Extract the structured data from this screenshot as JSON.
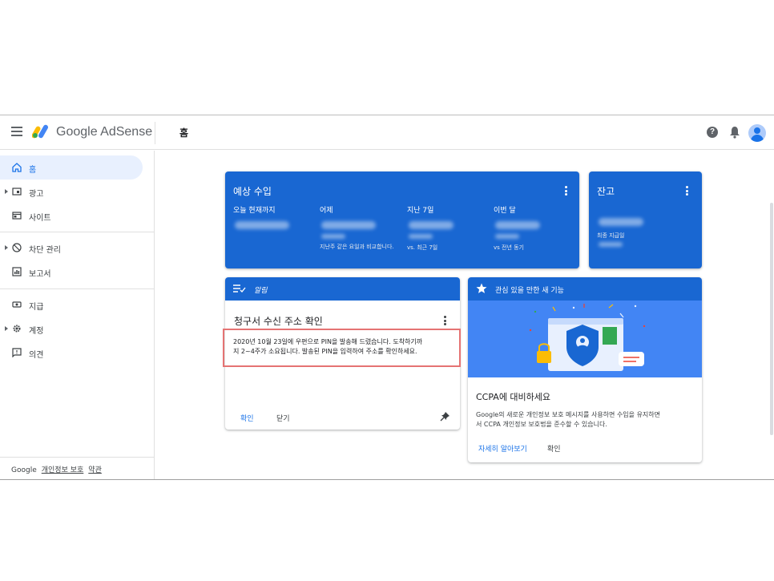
{
  "app": {
    "brand": "Google AdSense",
    "page_title": "홈"
  },
  "colors": {
    "primary": "#1967d2",
    "accent": "#1a73e8",
    "highlight_border": "#e57373"
  },
  "sidebar": {
    "items": [
      {
        "label": "홈",
        "icon": "home-icon",
        "active": true
      },
      {
        "label": "광고",
        "icon": "ads-icon",
        "expandable": true
      },
      {
        "label": "사이트",
        "icon": "sites-icon"
      },
      {
        "label": "차단 관리",
        "icon": "block-icon",
        "expandable": true
      },
      {
        "label": "보고서",
        "icon": "reports-icon"
      },
      {
        "label": "지급",
        "icon": "payments-icon"
      },
      {
        "label": "계정",
        "icon": "gear-icon",
        "expandable": true
      },
      {
        "label": "의견",
        "icon": "feedback-icon"
      }
    ],
    "footer": {
      "brand": "Google",
      "privacy": "개인정보 보호",
      "terms": "약관"
    }
  },
  "earnings": {
    "title": "예상 수입",
    "columns": [
      {
        "label": "오늘 현재까지",
        "note": ""
      },
      {
        "label": "어제",
        "note": "지난주 같은 요일과 비교합니다."
      },
      {
        "label": "지난 7일",
        "note": "vs. 최근 7일"
      },
      {
        "label": "이번 달",
        "note": "vs 전년 동기"
      }
    ]
  },
  "balance": {
    "title": "잔고",
    "note": "최종 지급일"
  },
  "alerts": {
    "header": "알림",
    "title": "청구서 수신 주소 확인",
    "body_line1": "2020년 10월 23일에 우편으로 PIN을 발송해 드렸습니다. 도착하기까",
    "body_line2": "지 2~4주가 소요됩니다. 발송된 PIN을 입력하여 주소를 확인하세요.",
    "confirm": "확인",
    "close": "닫기"
  },
  "feature": {
    "header": "관심 있을 만한 새 기능",
    "title": "CCPA에 대비하세요",
    "body_line1": "Google의 새로운 개인정보 보호 메시지를 사용하면 수입을 유지하면",
    "body_line2": "서 CCPA 개인정보 보호법을 준수할 수 있습니다.",
    "learn_more": "자세히 알아보기",
    "confirm": "확인"
  }
}
